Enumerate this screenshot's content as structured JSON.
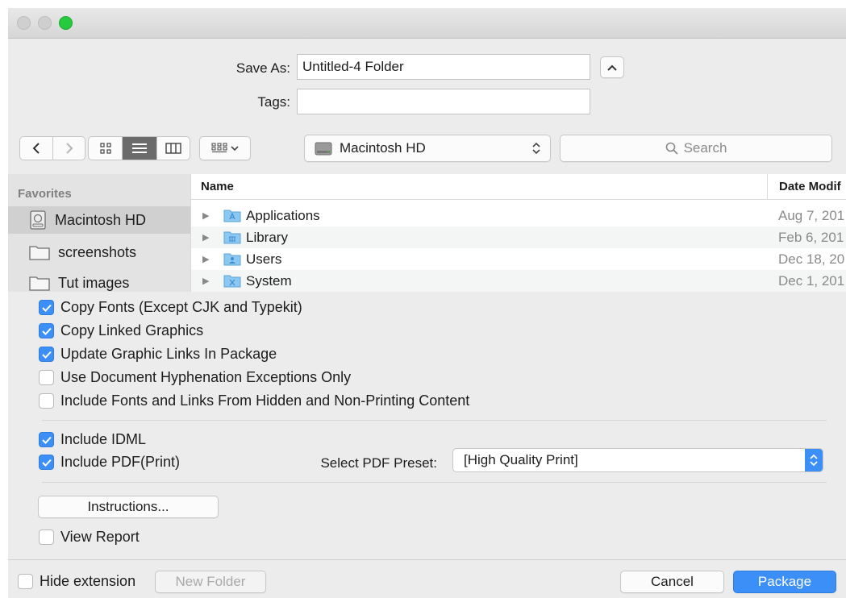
{
  "save_as": {
    "label": "Save As:",
    "value": "Untitled-4 Folder"
  },
  "tags": {
    "label": "Tags:",
    "value": ""
  },
  "toolbar": {
    "location": "Macintosh HD",
    "search_placeholder": "Search"
  },
  "sidebar": {
    "heading": "Favorites",
    "items": [
      {
        "label": "Macintosh HD",
        "icon": "hard-drive-icon",
        "selected": true
      },
      {
        "label": "screenshots",
        "icon": "folder-icon",
        "selected": false
      },
      {
        "label": "Tut images",
        "icon": "folder-icon",
        "selected": false
      }
    ]
  },
  "file_list": {
    "columns": {
      "name": "Name",
      "date": "Date Modif"
    },
    "rows": [
      {
        "name": "Applications",
        "date": "Aug 7, 201",
        "icon": "applications-folder-icon"
      },
      {
        "name": "Library",
        "date": "Feb 6, 201",
        "icon": "library-folder-icon"
      },
      {
        "name": "Users",
        "date": "Dec 18, 20",
        "icon": "users-folder-icon"
      },
      {
        "name": "System",
        "date": "Dec 1, 201",
        "icon": "system-folder-icon"
      }
    ]
  },
  "options": [
    {
      "label": "Copy Fonts (Except CJK and Typekit)",
      "checked": true
    },
    {
      "label": "Copy Linked Graphics",
      "checked": true
    },
    {
      "label": "Update Graphic Links In Package",
      "checked": true
    },
    {
      "label": "Use Document Hyphenation Exceptions Only",
      "checked": false
    },
    {
      "label": "Include Fonts and Links From Hidden and Non-Printing Content",
      "checked": false
    }
  ],
  "export": {
    "idml": {
      "label": "Include IDML",
      "checked": true
    },
    "pdf": {
      "label": "Include PDF(Print)",
      "checked": true
    },
    "preset_label": "Select PDF Preset:",
    "preset_value": "[High Quality Print]"
  },
  "instructions_button": "Instructions...",
  "view_report": {
    "label": "View Report",
    "checked": false
  },
  "footer": {
    "hide_extension": {
      "label": "Hide extension",
      "checked": false
    },
    "new_folder": "New Folder",
    "cancel": "Cancel",
    "package": "Package"
  },
  "colors": {
    "accent": "#3b8ff6",
    "zoom": "#27c93f"
  }
}
